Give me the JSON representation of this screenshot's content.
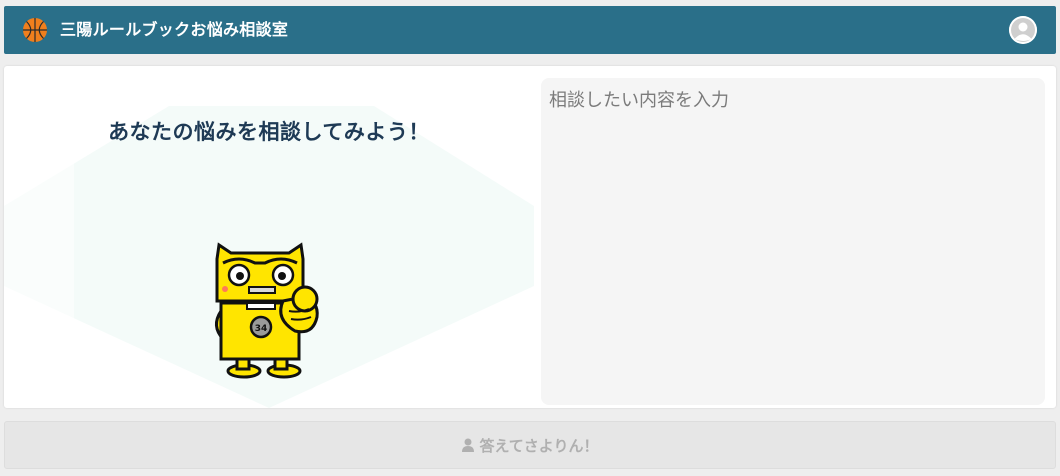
{
  "header": {
    "title": "三陽ルールブックお悩み相談室",
    "logo_icon": "basketball-icon",
    "avatar_icon": "user-avatar-icon",
    "background_color": "#2a6f89"
  },
  "main": {
    "heading": "あなたの悩みを相談してみよう！",
    "mascot_icon": "yellow-robot-mascot",
    "mascot_badge": "34",
    "input": {
      "value": "",
      "placeholder": "相談したい内容を入力"
    }
  },
  "submit": {
    "label": "答えてさよりん！",
    "icon": "person-icon"
  }
}
